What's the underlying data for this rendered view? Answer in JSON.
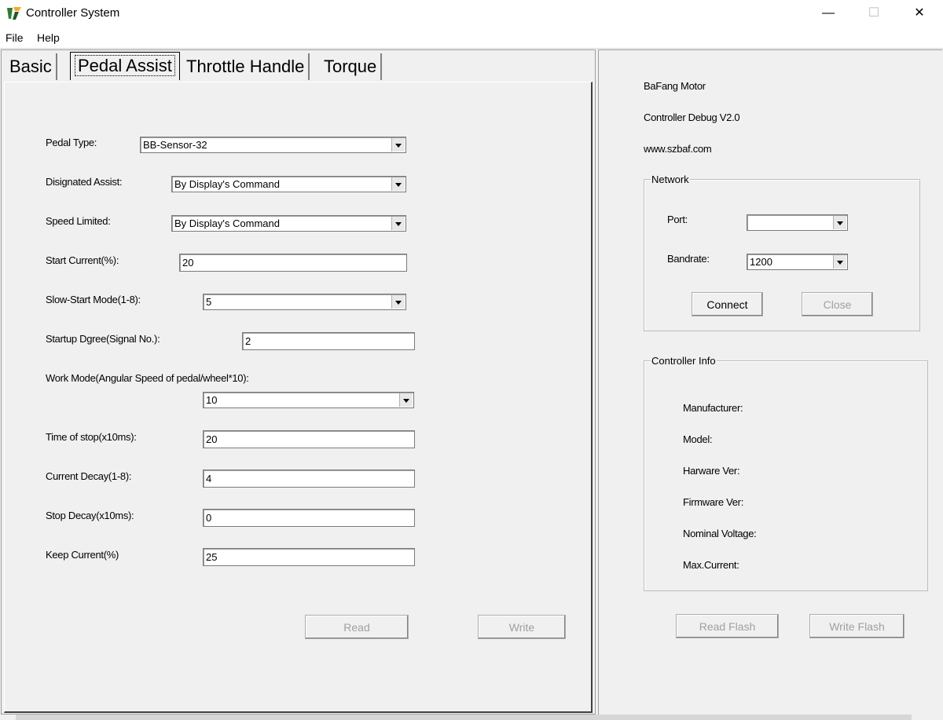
{
  "window": {
    "title": "Controller System",
    "minimize": "—",
    "maximize": "☐",
    "close": "✕"
  },
  "menu": {
    "file": "File",
    "help": "Help"
  },
  "tabs": {
    "basic": "Basic",
    "pedal_assist": "Pedal Assist",
    "throttle_handle": "Throttle Handle",
    "torque": "Torque"
  },
  "form": {
    "pedal_type": {
      "label": "Pedal Type:",
      "value": "BB-Sensor-32"
    },
    "designated_assist": {
      "label": "Disignated Assist:",
      "value": "By Display's Command"
    },
    "speed_limited": {
      "label": "Speed Limited:",
      "value": "By Display's Command"
    },
    "start_current": {
      "label": "Start Current(%):",
      "value": "20"
    },
    "slow_start_mode": {
      "label": "Slow-Start Mode(1-8):",
      "value": "5"
    },
    "startup_degree": {
      "label": "Startup Dgree(Signal No.):",
      "value": "2"
    },
    "work_mode": {
      "label": "Work Mode(Angular Speed of pedal/wheel*10):",
      "value": "10"
    },
    "time_of_stop": {
      "label": "Time of stop(x10ms):",
      "value": "20"
    },
    "current_decay": {
      "label": "Current Decay(1-8):",
      "value": "4"
    },
    "stop_decay": {
      "label": "Stop Decay(x10ms):",
      "value": "0"
    },
    "keep_current": {
      "label": "Keep Current(%)",
      "value": "25"
    },
    "read_button": "Read",
    "write_button": "Write"
  },
  "info": {
    "line1": "BaFang Motor",
    "line2": "Controller Debug V2.0",
    "line3": "www.szbaf.com"
  },
  "network": {
    "title": "Network",
    "port_label": "Port:",
    "port_value": "",
    "bandrate_label": "Bandrate:",
    "bandrate_value": "1200",
    "connect_button": "Connect",
    "close_button": "Close"
  },
  "controller_info": {
    "title": "Controller Info",
    "manufacturer": "Manufacturer:",
    "model": "Model:",
    "hardware_ver": "Harware Ver:",
    "firmware_ver": "Firmware Ver:",
    "nominal_voltage": "Nominal Voltage:",
    "max_current": "Max.Current:"
  },
  "flash": {
    "read_flash": "Read Flash",
    "write_flash": "Write Flash"
  },
  "colors": {
    "window_bg": "#f0f0f0",
    "titlebar_bg": "#ffffff",
    "disabled_text": "#a0a0a0"
  }
}
